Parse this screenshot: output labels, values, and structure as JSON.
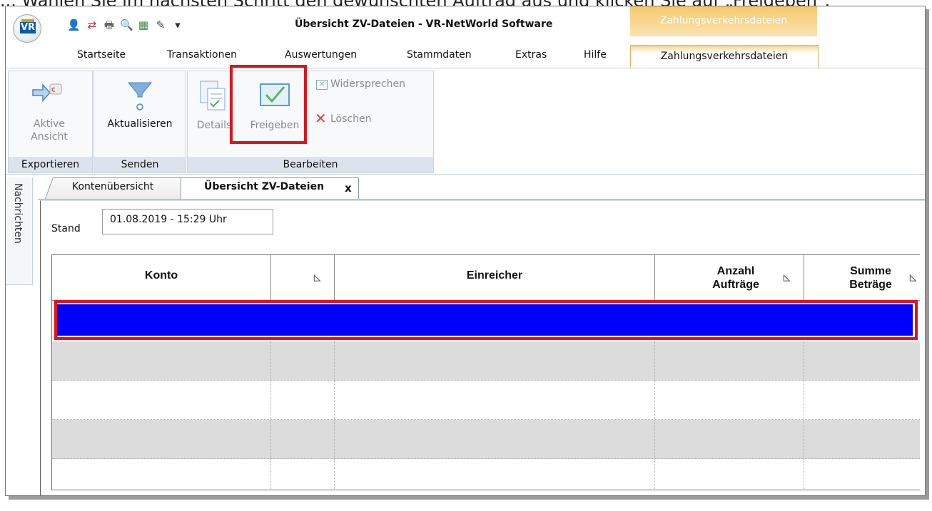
{
  "top_caption": "... Wählen Sie im nächsten Schritt den gewünschten Auftrag aus und klicken Sie auf „Freigeben“.",
  "window": {
    "title": "Übersicht ZV-Dateien - VR-NetWorld Software",
    "app_logo": "VR",
    "context_group": "Zahlungsverkehrsdateien",
    "qat_dropdown": "▾"
  },
  "ribbon_tabs": [
    "Startseite",
    "Transaktionen",
    "Auswertungen",
    "Stammdaten",
    "Extras",
    "Hilfe",
    "Zahlungsverkehrsdateien"
  ],
  "ribbon": {
    "exportieren": {
      "button_line1": "Aktive",
      "button_line2": "Ansicht",
      "group": "Exportieren"
    },
    "senden": {
      "button": "Aktualisieren",
      "group": "Senden"
    },
    "bearbeiten": {
      "details": "Details",
      "freigeben": "Freigeben",
      "widersprechen": "Widersprechen",
      "loeschen": "Löschen",
      "group": "Bearbeiten"
    }
  },
  "side_panel": "Nachrichten",
  "doc_tabs": [
    "Kontenübersicht",
    "Übersicht ZV-Dateien"
  ],
  "doc_tab_close": "x",
  "stand": {
    "label": "Stand",
    "value": "01.08.2019 - 15:29 Uhr"
  },
  "grid": {
    "columns": [
      {
        "label": "Konto"
      },
      {
        "label": ""
      },
      {
        "label": "Einreicher"
      },
      {
        "label": "Anzahl Aufträge",
        "line1": "Anzahl",
        "line2": "Aufträge"
      },
      {
        "label": "Summe Beträge",
        "line1": "Summe",
        "line2": "Beträge"
      }
    ]
  },
  "colors": {
    "selection": "#0000ff",
    "highlight_frame": "#e0141a",
    "context_tab": "#f6c86e"
  }
}
